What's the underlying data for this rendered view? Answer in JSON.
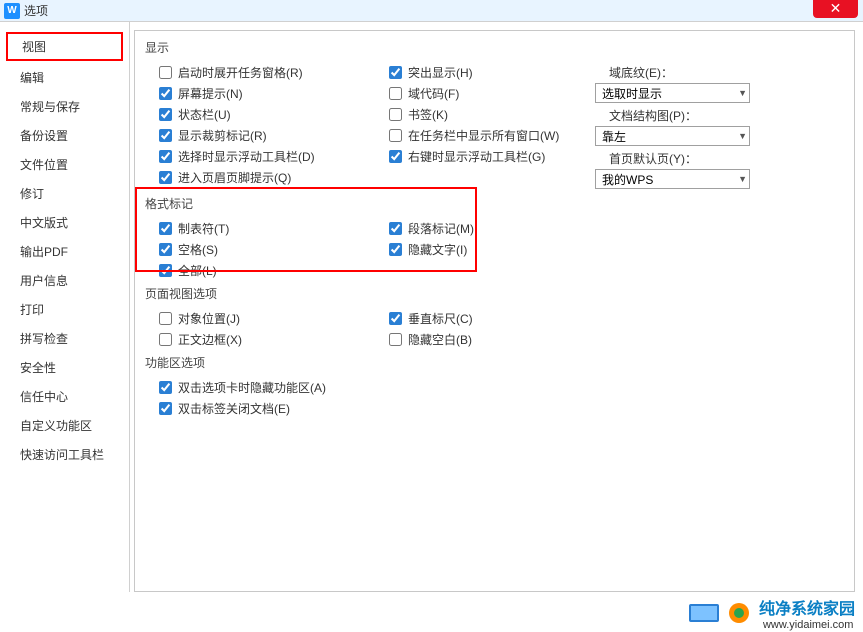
{
  "titlebar": {
    "title": "选项"
  },
  "sidebar": {
    "items": [
      {
        "label": "视图",
        "active": true
      },
      {
        "label": "编辑"
      },
      {
        "label": "常规与保存"
      },
      {
        "label": "备份设置"
      },
      {
        "label": "文件位置"
      },
      {
        "label": "修订"
      },
      {
        "label": "中文版式"
      },
      {
        "label": "输出PDF"
      },
      {
        "label": "用户信息"
      },
      {
        "label": "打印"
      },
      {
        "label": "拼写检查"
      },
      {
        "label": "安全性"
      },
      {
        "label": "信任中心"
      },
      {
        "label": "自定义功能区"
      },
      {
        "label": "快速访问工具栏"
      }
    ]
  },
  "sections": {
    "display": {
      "title": "显示",
      "col1": [
        {
          "label": "启动时展开任务窗格(R)",
          "checked": false
        },
        {
          "label": "屏幕提示(N)",
          "checked": true
        },
        {
          "label": "状态栏(U)",
          "checked": true
        },
        {
          "label": "显示裁剪标记(R)",
          "checked": true
        },
        {
          "label": "选择时显示浮动工具栏(D)",
          "checked": true
        },
        {
          "label": "进入页眉页脚提示(Q)",
          "checked": true
        }
      ],
      "col2": [
        {
          "label": "突出显示(H)",
          "checked": true
        },
        {
          "label": "域代码(F)",
          "checked": false
        },
        {
          "label": "书签(K)",
          "checked": false
        },
        {
          "label": "在任务栏中显示所有窗口(W)",
          "checked": false
        },
        {
          "label": "右键时显示浮动工具栏(G)",
          "checked": true
        }
      ],
      "col3_labels": [
        "域底纹(E)：",
        "",
        "文档结构图(P)：",
        "",
        "首页默认页(Y)："
      ],
      "col3_combos": {
        "c1": "选取时显示",
        "c2": "靠左",
        "c3": "我的WPS"
      }
    },
    "format": {
      "title": "格式标记",
      "col1": [
        {
          "label": "制表符(T)",
          "checked": true
        },
        {
          "label": "空格(S)",
          "checked": true
        },
        {
          "label": "全部(L)",
          "checked": true
        }
      ],
      "col2": [
        {
          "label": "段落标记(M)",
          "checked": true
        },
        {
          "label": "隐藏文字(I)",
          "checked": true
        }
      ]
    },
    "pageview": {
      "title": "页面视图选项",
      "col1": [
        {
          "label": "对象位置(J)",
          "checked": false
        },
        {
          "label": "正文边框(X)",
          "checked": false
        }
      ],
      "col2": [
        {
          "label": "垂直标尺(C)",
          "checked": true
        },
        {
          "label": "隐藏空白(B)",
          "checked": false
        }
      ]
    },
    "ribbon": {
      "title": "功能区选项",
      "col1": [
        {
          "label": "双击选项卡时隐藏功能区(A)",
          "checked": true
        },
        {
          "label": "双击标签关闭文档(E)",
          "checked": true
        }
      ]
    }
  },
  "footer": {
    "brand": "纯净系统家园",
    "url": "www.yidaimei.com"
  }
}
